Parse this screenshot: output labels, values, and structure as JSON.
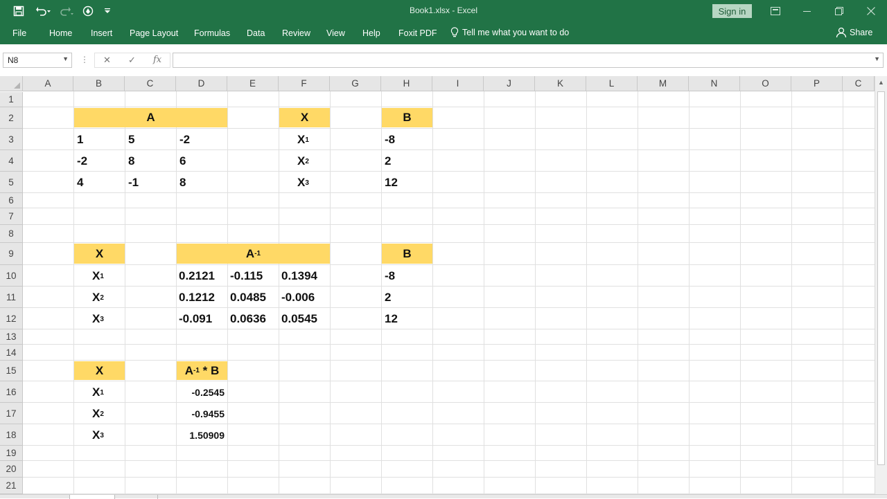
{
  "window": {
    "title": "Book1.xlsx  -  Excel",
    "sign_in": "Sign in"
  },
  "ribbon": {
    "tabs": [
      "File",
      "Home",
      "Insert",
      "Page Layout",
      "Formulas",
      "Data",
      "Review",
      "View",
      "Help",
      "Foxit PDF"
    ],
    "tell_me": "Tell me what you want to do",
    "share": "Share"
  },
  "formula_bar": {
    "name_box": "N8",
    "formula": "",
    "fx_label": "fx"
  },
  "grid": {
    "columns": [
      "A",
      "B",
      "C",
      "D",
      "E",
      "F",
      "G",
      "H",
      "I",
      "J",
      "K",
      "L",
      "M",
      "N",
      "O",
      "P",
      "C"
    ],
    "rows": [
      "1",
      "2",
      "3",
      "4",
      "5",
      "6",
      "7",
      "8",
      "9",
      "10",
      "11",
      "12",
      "13",
      "14",
      "15",
      "16",
      "17",
      "18",
      "19",
      "20",
      "21"
    ]
  },
  "cells": {
    "matrix_a_header": "A",
    "matrix_a": [
      [
        "1",
        "5",
        "-2"
      ],
      [
        "-2",
        "8",
        "6"
      ],
      [
        "4",
        "-1",
        "8"
      ]
    ],
    "x_header": "X",
    "x_vars": [
      {
        "base": "X",
        "sub": "1"
      },
      {
        "base": "X",
        "sub": "2"
      },
      {
        "base": "X",
        "sub": "3"
      }
    ],
    "b_header": "B",
    "b_values": [
      "-8",
      "2",
      "12"
    ],
    "inverse_header": {
      "base": "A",
      "sup": "-1"
    },
    "inverse": [
      [
        "0.2121",
        "-0.115",
        "0.1394"
      ],
      [
        "0.1212",
        "0.0485",
        "-0.006"
      ],
      [
        "-0.091",
        "0.0636",
        "0.0545"
      ]
    ],
    "result_header": {
      "base": "A",
      "sup": "-1",
      "rest": " * B"
    },
    "result": [
      "-0.2545",
      "-0.9455",
      "1.50909"
    ]
  },
  "colors": {
    "excel_green": "#217346",
    "header_fill": "#ffd966"
  }
}
